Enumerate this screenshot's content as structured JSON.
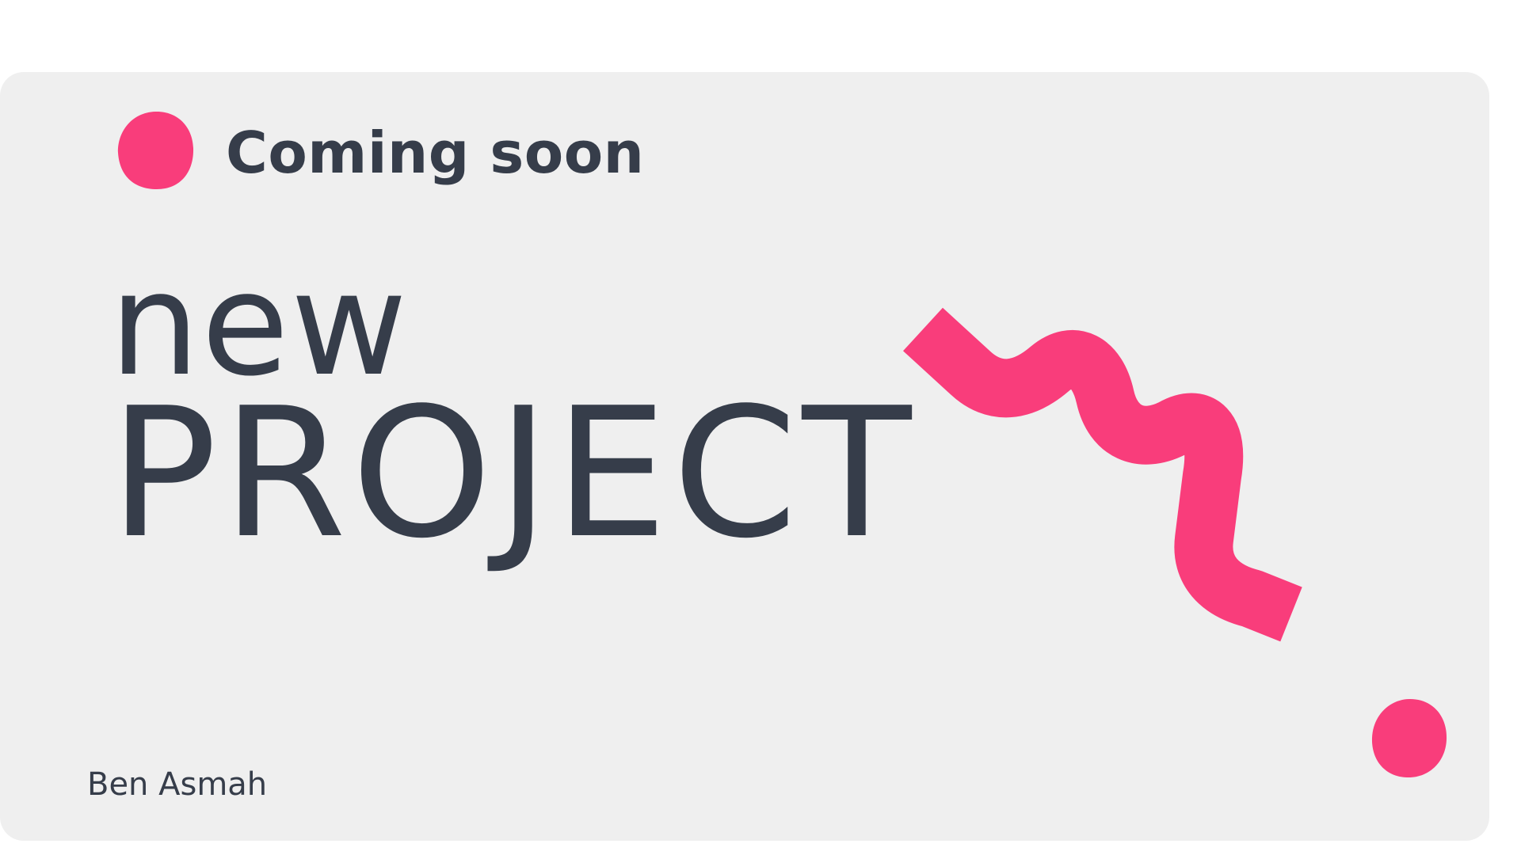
{
  "heading": {
    "tagline": "Coming soon",
    "line1": "new",
    "line2": "PROJECT"
  },
  "footer": {
    "author": "Ben Asmah"
  },
  "colors": {
    "background": "#ffffff",
    "card": "#efefef",
    "accent": "#f93d7b",
    "text": "#363d4a"
  },
  "decorations": {
    "top_dot": "pink-dot-icon",
    "bottom_dot": "pink-dot-icon",
    "squiggle": "pink-squiggle-icon"
  }
}
